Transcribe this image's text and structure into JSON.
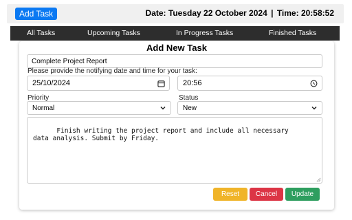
{
  "header": {
    "add_task_label": "Add Task",
    "date_label": "Date:",
    "date_value": "Tuesday 22 October 2024",
    "separator": "|",
    "time_label": "Time:",
    "time_value": "20:58:52"
  },
  "nav": {
    "items": [
      {
        "label": "All Tasks"
      },
      {
        "label": "Upcoming Tasks"
      },
      {
        "label": "In Progress Tasks"
      },
      {
        "label": "Finished Tasks"
      }
    ]
  },
  "form": {
    "title": "Add New Task",
    "task_title_value": "Complete Project Report",
    "notify_label": "Please provide the notifying date and time for your task:",
    "date_value": "25/10/2024",
    "time_value": "20:56",
    "priority_label": "Priority",
    "priority_value": "Normal",
    "status_label": "Status",
    "status_value": "New",
    "description_value": "Finish writing the project report and include all necessary\ndata analysis. Submit by Friday.",
    "reset_label": "Reset",
    "cancel_label": "Cancel",
    "update_label": "Update"
  },
  "colors": {
    "accent_blue": "#0b79f2",
    "nav_bg": "#2d2d2d",
    "reset_yellow": "#f0b429",
    "cancel_red": "#dc3545",
    "update_green": "#2e9e5f"
  },
  "icons": {
    "date_icon": "calendar-icon",
    "time_icon": "clock-icon",
    "select_icon": "chevron-down-icon"
  }
}
